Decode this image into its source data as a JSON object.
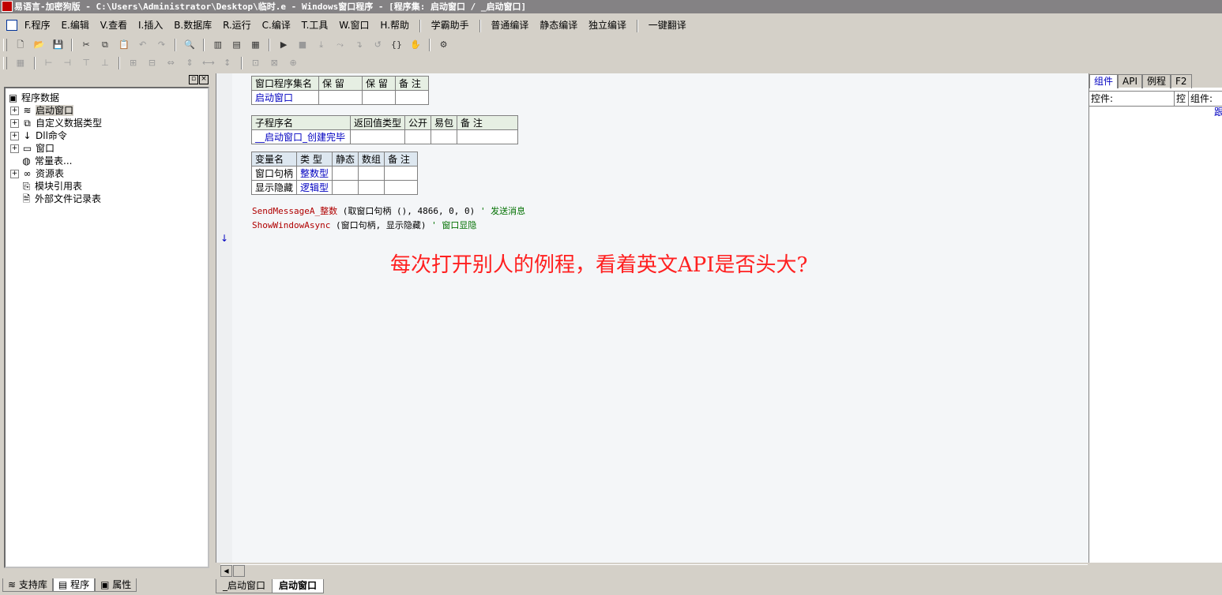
{
  "window": {
    "title": "易语言-加密狗版 - C:\\Users\\Administrator\\Desktop\\临时.e - Windows窗口程序 - [程序集: 启动窗口 / _启动窗口]"
  },
  "menu": {
    "items": [
      "F.程序",
      "E.编辑",
      "V.查看",
      "I.插入",
      "B.数据库",
      "R.运行",
      "C.编译",
      "T.工具",
      "W.窗口",
      "H.帮助"
    ],
    "extra": [
      "学霸助手",
      "普通编译",
      "静态编译",
      "独立编译"
    ],
    "translate": "一键翻译"
  },
  "toolbar1": {
    "icons": [
      "new-file-icon",
      "open-folder-icon",
      "save-icon",
      "cut-icon",
      "copy-icon",
      "paste-icon",
      "undo-icon",
      "redo-icon",
      "find-icon",
      "layout1-icon",
      "layout2-icon",
      "layout3-icon",
      "run-icon",
      "stop-icon",
      "step1-icon",
      "step2-icon",
      "step3-icon",
      "step4-icon",
      "step5-icon",
      "hand-icon",
      "tool-icon"
    ]
  },
  "tree": {
    "root": "程序数据",
    "items": [
      {
        "label": "启动窗口",
        "expandable": true,
        "selected": true
      },
      {
        "label": "自定义数据类型",
        "expandable": true
      },
      {
        "label": "Dll命令",
        "expandable": true
      },
      {
        "label": "窗口",
        "expandable": true
      },
      {
        "label": "常量表...",
        "expandable": false
      },
      {
        "label": "资源表",
        "expandable": true
      },
      {
        "label": "模块引用表",
        "expandable": false
      },
      {
        "label": "外部文件记录表",
        "expandable": false
      }
    ]
  },
  "left_tabs": [
    "支持库",
    "程序",
    "属性"
  ],
  "assembly_table": {
    "headers": [
      "窗口程序集名",
      "保 留",
      "保 留",
      "备 注"
    ],
    "row": [
      "启动窗口",
      "",
      "",
      ""
    ]
  },
  "sub_table": {
    "headers": [
      "子程序名",
      "返回值类型",
      "公开",
      "易包",
      "备 注"
    ],
    "row": [
      "__启动窗口_创建完毕",
      "",
      "",
      "",
      ""
    ]
  },
  "var_table": {
    "headers": [
      "变量名",
      "类 型",
      "静态",
      "数组",
      "备 注"
    ],
    "rows": [
      [
        "窗口句柄",
        "整数型",
        "",
        "",
        ""
      ],
      [
        "显示隐藏",
        "逻辑型",
        "",
        "",
        ""
      ]
    ]
  },
  "code": {
    "line1": {
      "fn": "SendMessageA_整数",
      "args": " (取窗口句柄 (), 4866, 0, 0) ",
      "comment": "' 发送消息"
    },
    "line2": {
      "fn": "ShowWindowAsync",
      "args": " (窗口句柄, 显示隐藏) ",
      "comment": "' 窗口显隐"
    }
  },
  "banner": "每次打开别人的例程，看着英文API是否头大?",
  "editor_tabs": [
    "_启动窗口",
    "启动窗口"
  ],
  "right_tabs": [
    "组件",
    "API",
    "例程",
    "F2"
  ],
  "right_row": {
    "label1": "控件:",
    "label2": "控",
    "label3": "组件:"
  },
  "right_trail": "跟"
}
